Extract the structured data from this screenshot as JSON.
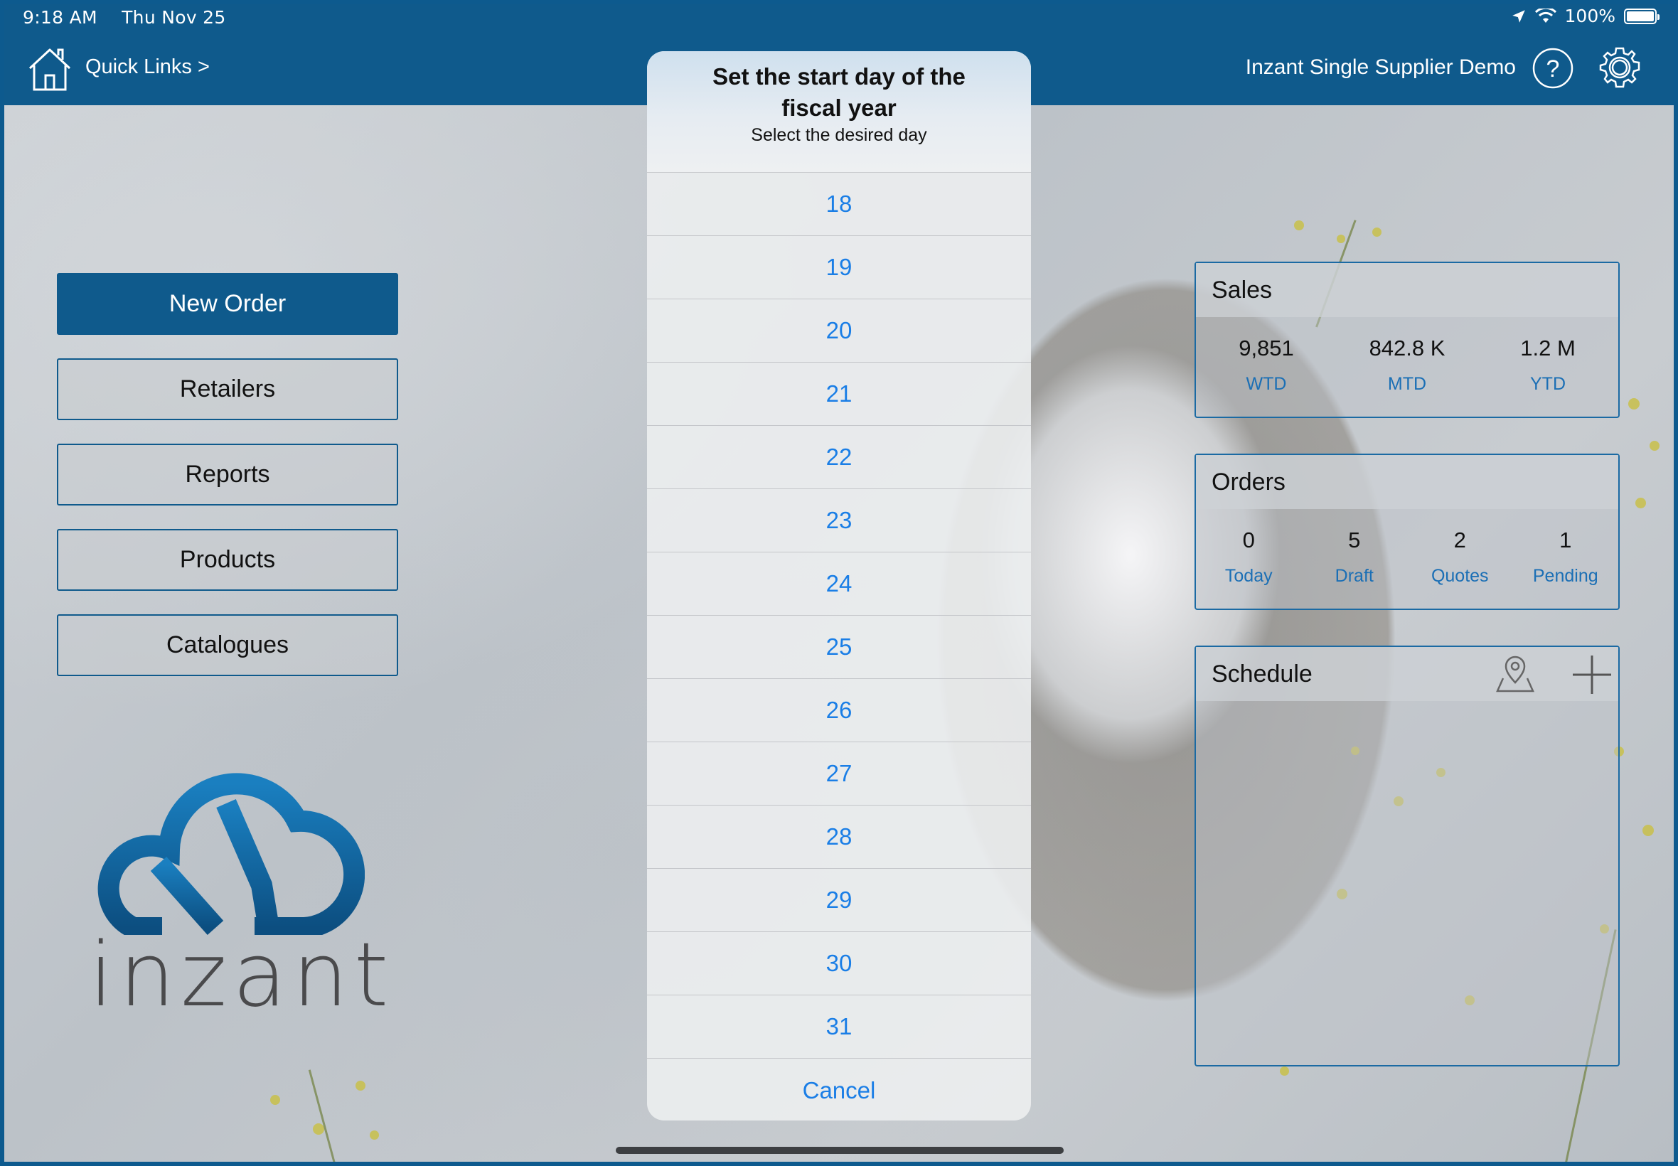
{
  "status_bar": {
    "time": "9:18 AM",
    "date": "Thu Nov 25",
    "battery": "100%"
  },
  "header": {
    "quick_links": "Quick Links >",
    "company": "Inzant Single Supplier Demo"
  },
  "menu": [
    {
      "label": "New Order"
    },
    {
      "label": "Retailers"
    },
    {
      "label": "Reports"
    },
    {
      "label": "Products"
    },
    {
      "label": "Catalogues"
    }
  ],
  "logo": {
    "text": "inzant"
  },
  "sales": {
    "title": "Sales",
    "stats": [
      {
        "value": "9,851",
        "label": "WTD"
      },
      {
        "value": "842.8 K",
        "label": "MTD"
      },
      {
        "value": "1.2 M",
        "label": "YTD"
      }
    ]
  },
  "orders": {
    "title": "Orders",
    "stats": [
      {
        "value": "0",
        "label": "Today"
      },
      {
        "value": "5",
        "label": "Draft"
      },
      {
        "value": "2",
        "label": "Quotes"
      },
      {
        "value": "1",
        "label": "Pending"
      }
    ]
  },
  "schedule": {
    "title": "Schedule"
  },
  "sheet": {
    "title": "Set the start day of the fiscal year",
    "subtitle": "Select the desired day",
    "days": [
      "18",
      "19",
      "20",
      "21",
      "22",
      "23",
      "24",
      "25",
      "26",
      "27",
      "28",
      "29",
      "30",
      "31"
    ],
    "cancel": "Cancel"
  },
  "colors": {
    "brand": "#0f5a8c",
    "link": "#1a7ee6"
  },
  "icons": [
    "home-icon",
    "help-icon",
    "gear-icon",
    "map-pin-icon",
    "plus-icon",
    "location-arrow-icon",
    "wifi-icon",
    "battery-icon"
  ]
}
